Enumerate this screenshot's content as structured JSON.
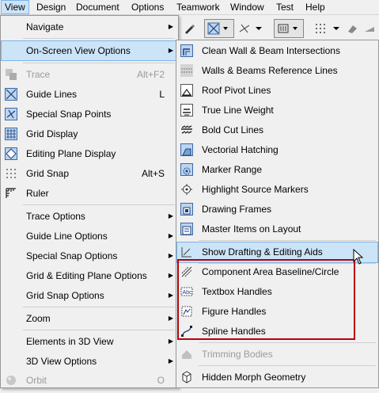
{
  "menubar": [
    "View",
    "Design",
    "Document",
    "Options",
    "Teamwork",
    "Window",
    "Test",
    "Help"
  ],
  "view_menu": {
    "navigate": "Navigate",
    "onscreen": "On-Screen View Options",
    "trace": "Trace",
    "trace_sc": "Alt+F2",
    "guide_lines": "Guide Lines",
    "guide_lines_sc": "L",
    "special_snap": "Special Snap Points",
    "grid_display": "Grid Display",
    "editing_plane": "Editing Plane Display",
    "grid_snap": "Grid Snap",
    "grid_snap_sc": "Alt+S",
    "ruler": "Ruler",
    "trace_options": "Trace Options",
    "guide_line_options": "Guide Line Options",
    "special_snap_options": "Special Snap Options",
    "grid_plane_options": "Grid & Editing Plane Options",
    "grid_snap_options": "Grid Snap Options",
    "zoom": "Zoom",
    "elements_3d": "Elements in 3D View",
    "view_3d_options": "3D View Options",
    "orbit": "Orbit",
    "orbit_sc": "O"
  },
  "submenu": {
    "clean_wall": "Clean Wall & Beam Intersections",
    "walls_ref": "Walls & Beams Reference Lines",
    "roof_pivot": "Roof Pivot Lines",
    "true_line": "True Line Weight",
    "bold_cut": "Bold Cut Lines",
    "vectorial": "Vectorial Hatching",
    "marker_range": "Marker Range",
    "highlight_src": "Highlight Source Markers",
    "drawing_frames": "Drawing Frames",
    "master_items": "Master Items on Layout",
    "show_drafting": "Show Drafting & Editing Aids",
    "component_area": "Component Area Baseline/Circle",
    "textbox_handles": "Textbox Handles",
    "figure_handles": "Figure Handles",
    "spline_handles": "Spline Handles",
    "trimming_bodies": "Trimming Bodies",
    "hidden_morph": "Hidden Morph Geometry"
  }
}
